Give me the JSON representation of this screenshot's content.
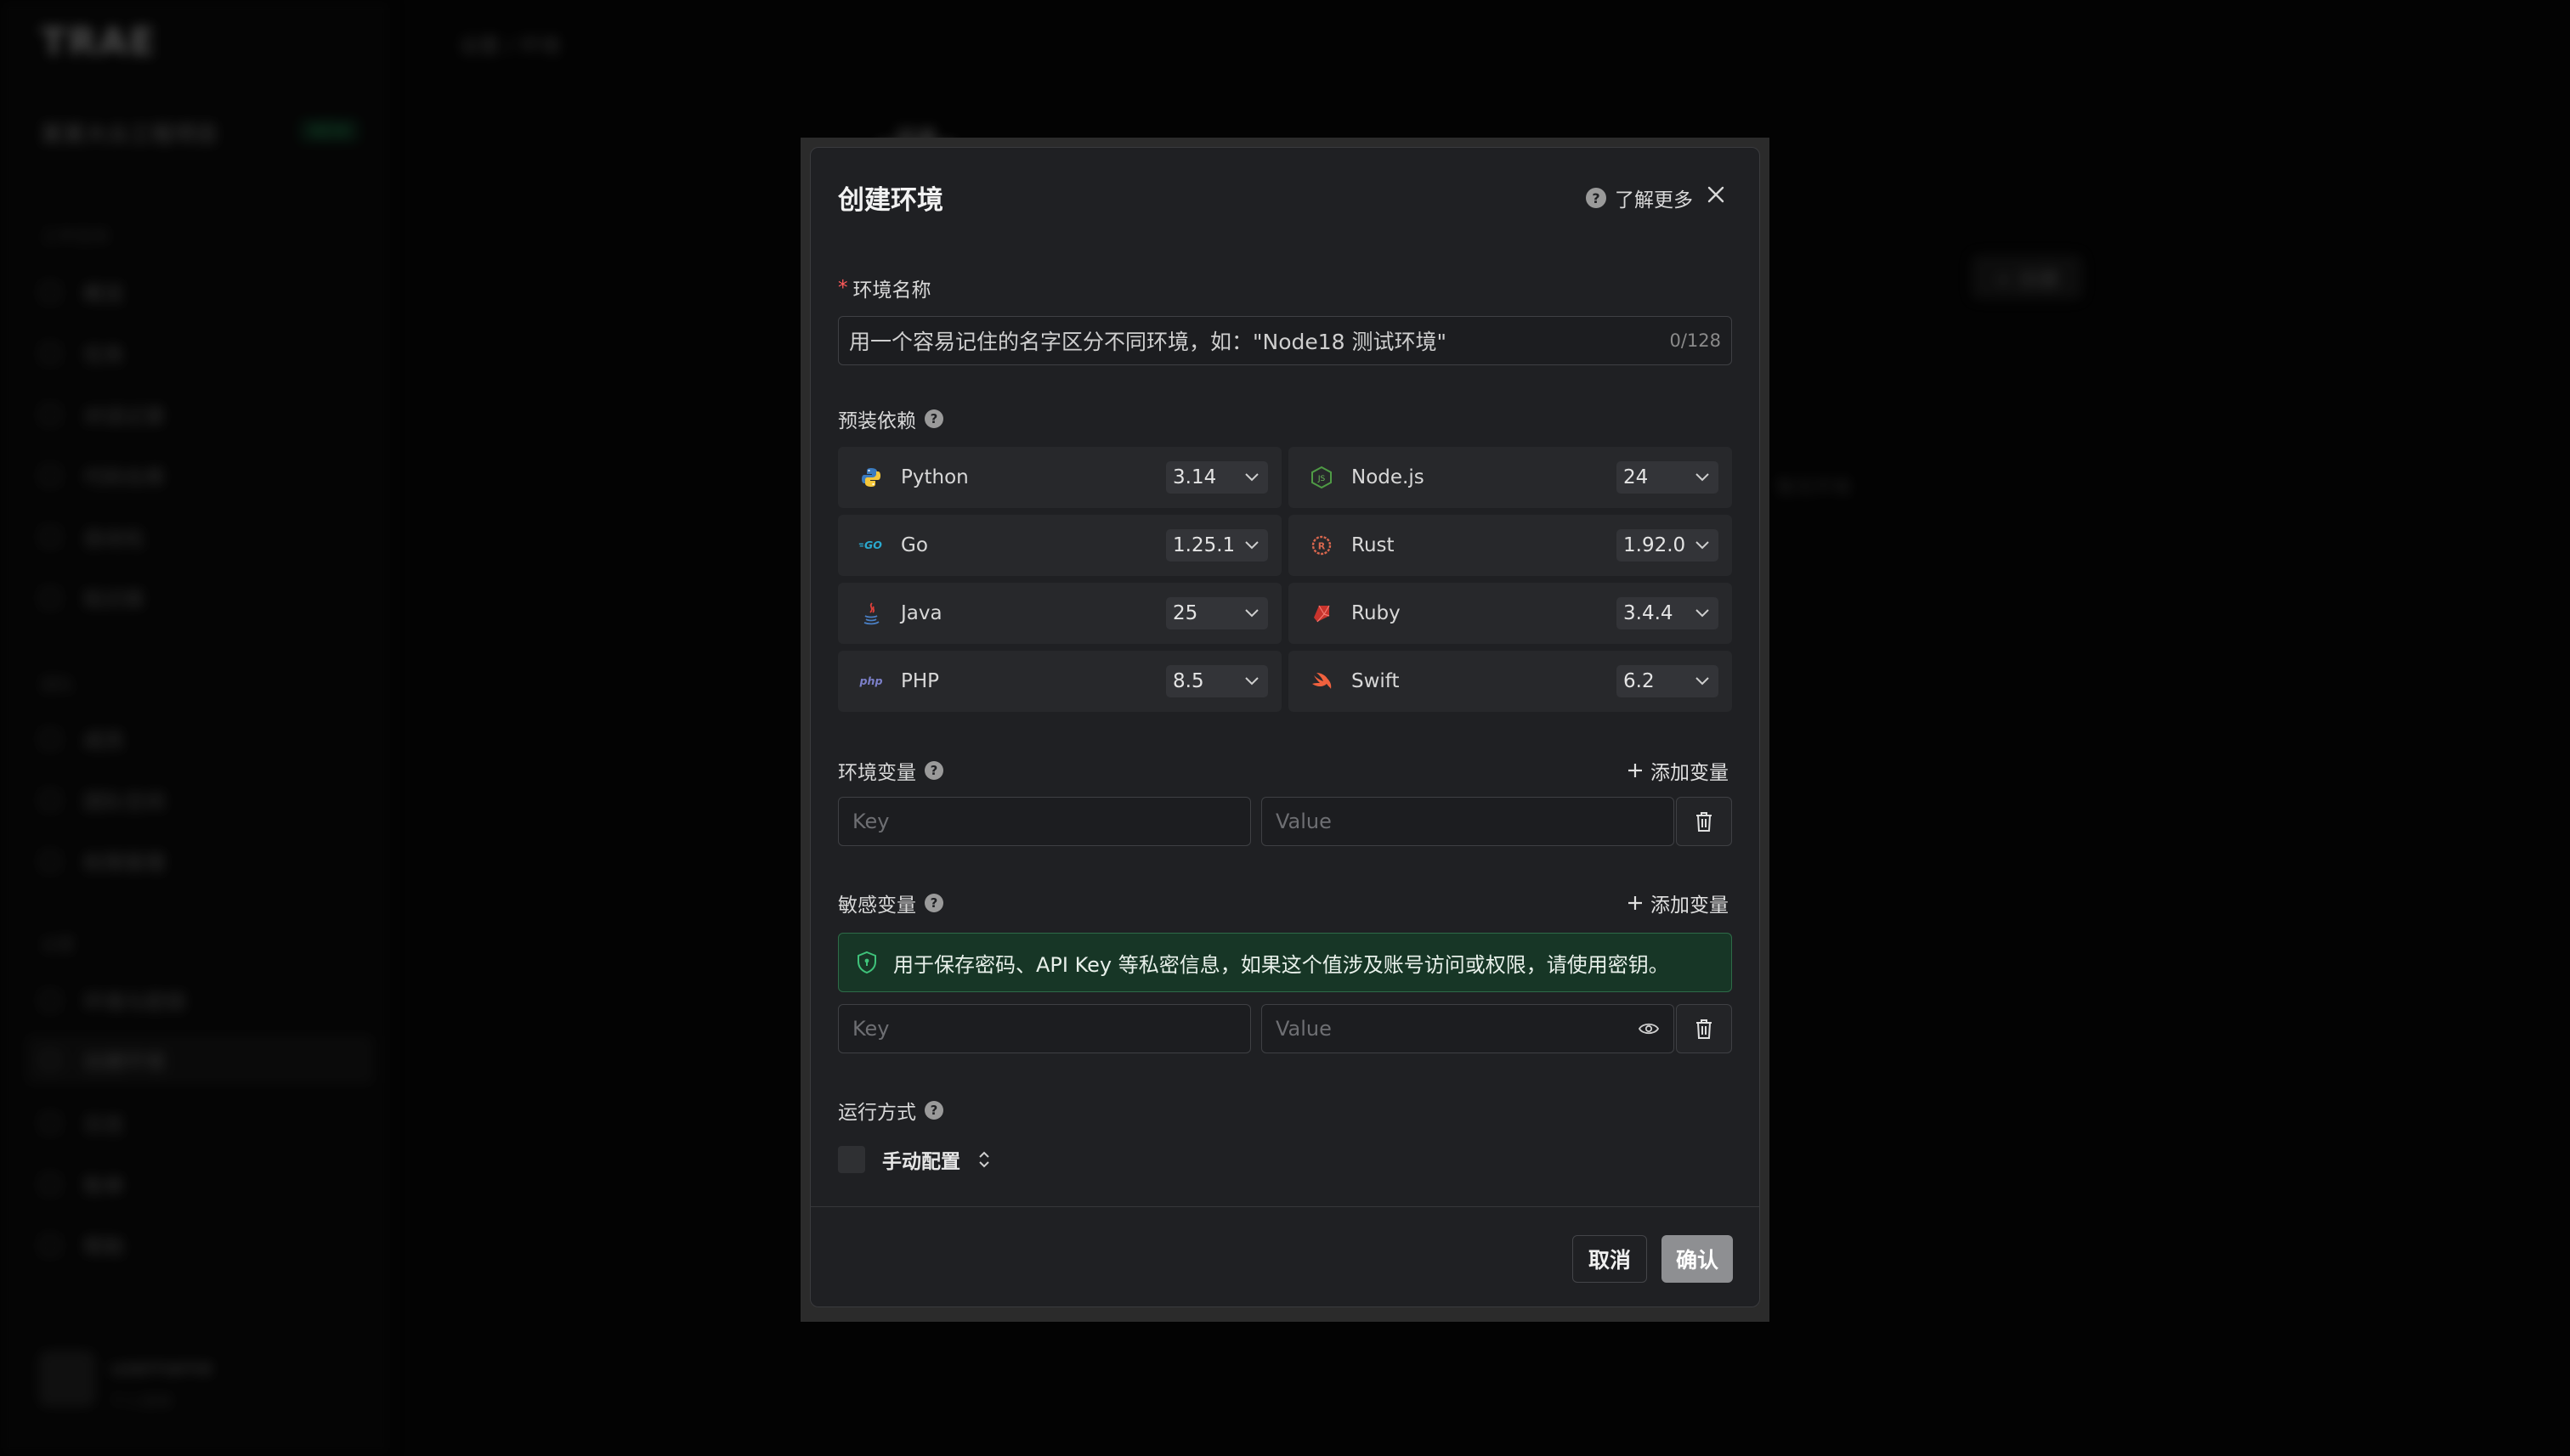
{
  "background": {
    "logo": "TRAE",
    "project_name": "某某大众工程项目",
    "project_badge": "NEW",
    "sections": [
      "工作空间",
      "团队",
      "设置"
    ],
    "nav_items": [
      "概览",
      "任务",
      "对话记录",
      "代码仓库",
      "自动化",
      "知识库",
      "成员",
      "团队空间",
      "权限管理",
      "环境与密钥",
      "创建环境",
      "日志",
      "账单",
      "帮助"
    ],
    "user_name": "username",
    "user_sub": "个人空间",
    "breadcrumb": "设置 / 环境",
    "tab": "环境",
    "button": "+ 创建",
    "note": "暂无环境"
  },
  "modal": {
    "title": "创建环境",
    "learn_more": "了解更多",
    "name_field": {
      "label": "环境名称",
      "placeholder": "用一个容易记住的名字区分不同环境，如：\"Node18 测试环境\"",
      "counter": "0/128"
    },
    "deps": {
      "label": "预装依赖",
      "items": [
        {
          "name": "Python",
          "version": "3.14",
          "icon": "python-icon"
        },
        {
          "name": "Node.js",
          "version": "24",
          "icon": "nodejs-icon"
        },
        {
          "name": "Go",
          "version": "1.25.1",
          "icon": "go-icon"
        },
        {
          "name": "Rust",
          "version": "1.92.0",
          "icon": "rust-icon"
        },
        {
          "name": "Java",
          "version": "25",
          "icon": "java-icon"
        },
        {
          "name": "Ruby",
          "version": "3.4.4",
          "icon": "ruby-icon"
        },
        {
          "name": "PHP",
          "version": "8.5",
          "icon": "php-icon"
        },
        {
          "name": "Swift",
          "version": "6.2",
          "icon": "swift-icon"
        }
      ]
    },
    "env_vars": {
      "label": "环境变量",
      "add": "添加变量",
      "key_placeholder": "Key",
      "value_placeholder": "Value"
    },
    "secret_vars": {
      "label": "敏感变量",
      "add": "添加变量",
      "banner": "用于保存密码、API Key 等私密信息，如果这个值涉及账号访问或权限，请使用密钥。",
      "key_placeholder": "Key",
      "value_placeholder": "Value"
    },
    "run_mode": {
      "label": "运行方式",
      "value": "手动配置"
    },
    "cancel": "取消",
    "confirm": "确认"
  },
  "colors": {
    "modal_bg": "#1f2023",
    "banner_bg": "#173626",
    "banner_border": "#2e6b48",
    "required": "#ff5a5a",
    "confirm_bg": "#8e8f92"
  }
}
